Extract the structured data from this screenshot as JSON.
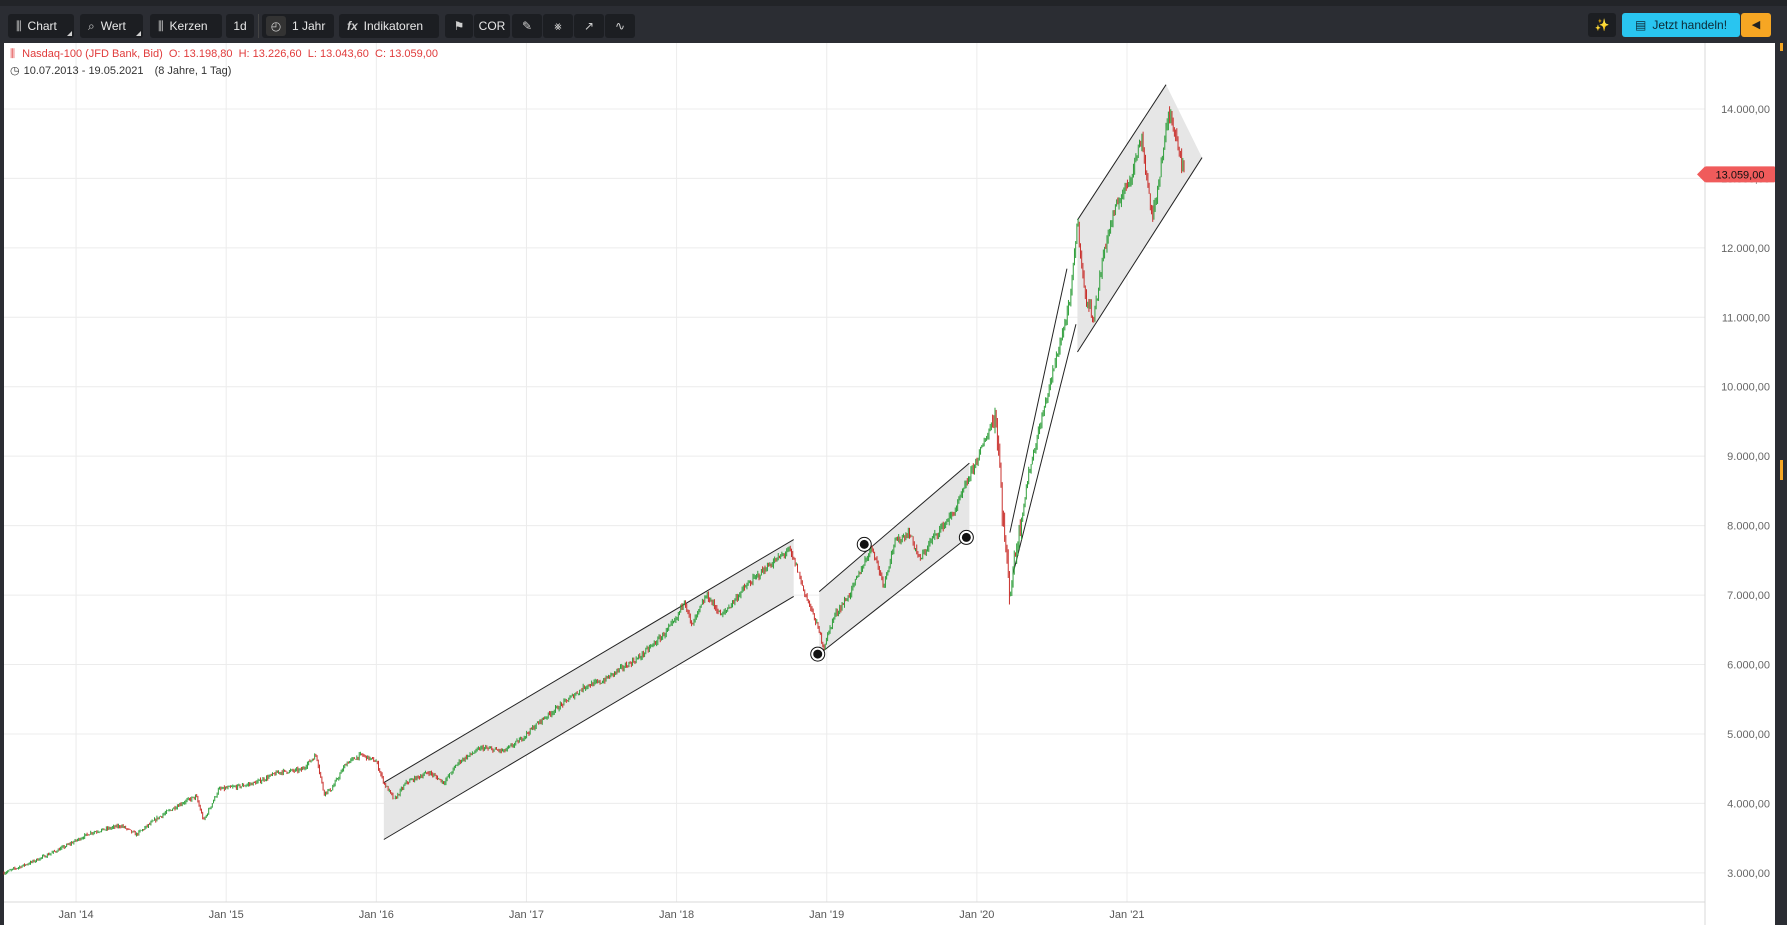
{
  "toolbar": {
    "chart_label": "Chart",
    "wert_label": "Wert",
    "kerzen_label": "Kerzen",
    "interval_label": "1d",
    "range_label": "1 Jahr",
    "indicators_label": "Indikatoren",
    "cor_label": "COR",
    "trade_label": "Jetzt handeln!"
  },
  "info": {
    "instrument": "Nasdaq-100 (JFD Bank, Bid)",
    "open": "O: 13.198,80",
    "high": "H: 13.226,60",
    "low": "L: 13.043,60",
    "close": "C: 13.059,00",
    "date_range": "10.07.2013 - 19.05.2021",
    "duration": "(8 Jahre, 1 Tag)"
  },
  "price_badge": "13.059,00",
  "colors": {
    "up": "#2e9e3a",
    "down": "#c9302c",
    "accent": "#f6a623",
    "trade": "#29c5f0",
    "badge": "#f05b5b"
  },
  "chart_data": {
    "type": "candlestick",
    "y_ticks": [
      "3.000,00",
      "4.000,00",
      "5.000,00",
      "6.000,00",
      "7.000,00",
      "8.000,00",
      "9.000,00",
      "10.000,00",
      "11.000,00",
      "12.000,00",
      "13.000,00",
      "14.000,00"
    ],
    "y_tick_values": [
      3000,
      4000,
      5000,
      6000,
      7000,
      8000,
      9000,
      10000,
      11000,
      12000,
      13000,
      14000
    ],
    "x_ticks": [
      "Jan '14",
      "Jan '15",
      "Jan '16",
      "Jan '17",
      "Jan '18",
      "Jan '19",
      "Jan '20",
      "Jan '21"
    ],
    "x_tick_values": [
      2014.0,
      2015.0,
      2016.0,
      2017.0,
      2018.0,
      2019.0,
      2020.0,
      2021.0
    ],
    "x_range": [
      2013.52,
      2024.85
    ],
    "y_range": [
      2580,
      14950
    ],
    "last_price": 13059,
    "price_path": [
      [
        2013.52,
        3000
      ],
      [
        2013.7,
        3150
      ],
      [
        2013.9,
        3350
      ],
      [
        2014.1,
        3580
      ],
      [
        2014.3,
        3680
      ],
      [
        2014.4,
        3550
      ],
      [
        2014.55,
        3800
      ],
      [
        2014.7,
        4000
      ],
      [
        2014.8,
        4100
      ],
      [
        2014.85,
        3750
      ],
      [
        2014.95,
        4200
      ],
      [
        2015.1,
        4250
      ],
      [
        2015.2,
        4300
      ],
      [
        2015.35,
        4450
      ],
      [
        2015.5,
        4480
      ],
      [
        2015.6,
        4700
      ],
      [
        2015.65,
        4150
      ],
      [
        2015.7,
        4200
      ],
      [
        2015.8,
        4580
      ],
      [
        2015.9,
        4700
      ],
      [
        2016.0,
        4600
      ],
      [
        2016.05,
        4300
      ],
      [
        2016.12,
        4050
      ],
      [
        2016.2,
        4300
      ],
      [
        2016.35,
        4450
      ],
      [
        2016.45,
        4300
      ],
      [
        2016.55,
        4600
      ],
      [
        2016.7,
        4800
      ],
      [
        2016.85,
        4750
      ],
      [
        2016.95,
        4900
      ],
      [
        2017.1,
        5200
      ],
      [
        2017.25,
        5450
      ],
      [
        2017.4,
        5700
      ],
      [
        2017.5,
        5750
      ],
      [
        2017.6,
        5900
      ],
      [
        2017.75,
        6100
      ],
      [
        2017.9,
        6400
      ],
      [
        2018.0,
        6650
      ],
      [
        2018.05,
        6950
      ],
      [
        2018.1,
        6550
      ],
      [
        2018.2,
        7000
      ],
      [
        2018.3,
        6700
      ],
      [
        2018.45,
        7100
      ],
      [
        2018.6,
        7400
      ],
      [
        2018.75,
        7650
      ],
      [
        2018.8,
        7400
      ],
      [
        2018.85,
        7050
      ],
      [
        2018.93,
        6600
      ],
      [
        2018.98,
        6250
      ],
      [
        2019.05,
        6700
      ],
      [
        2019.15,
        7000
      ],
      [
        2019.3,
        7700
      ],
      [
        2019.38,
        7150
      ],
      [
        2019.45,
        7750
      ],
      [
        2019.55,
        7900
      ],
      [
        2019.62,
        7500
      ],
      [
        2019.7,
        7800
      ],
      [
        2019.85,
        8200
      ],
      [
        2019.95,
        8700
      ],
      [
        2020.05,
        9200
      ],
      [
        2020.12,
        9600
      ],
      [
        2020.14,
        9300
      ],
      [
        2020.17,
        8200
      ],
      [
        2020.22,
        7000
      ],
      [
        2020.25,
        7500
      ],
      [
        2020.35,
        8800
      ],
      [
        2020.45,
        9700
      ],
      [
        2020.55,
        10600
      ],
      [
        2020.62,
        11200
      ],
      [
        2020.67,
        12400
      ],
      [
        2020.72,
        11300
      ],
      [
        2020.78,
        11000
      ],
      [
        2020.85,
        12000
      ],
      [
        2020.9,
        12400
      ],
      [
        2020.95,
        12700
      ],
      [
        2021.02,
        13000
      ],
      [
        2021.1,
        13600
      ],
      [
        2021.12,
        13200
      ],
      [
        2021.17,
        12400
      ],
      [
        2021.22,
        13100
      ],
      [
        2021.28,
        13950
      ],
      [
        2021.32,
        13700
      ],
      [
        2021.35,
        13400
      ],
      [
        2021.38,
        13060
      ]
    ],
    "channels": [
      {
        "a1": [
          2016.05,
          4300
        ],
        "a2": [
          2018.78,
          7800
        ],
        "b1": [
          2016.05,
          3480
        ],
        "b2": [
          2018.78,
          6980
        ]
      },
      {
        "a1": [
          2018.95,
          7050
        ],
        "a2": [
          2019.95,
          8900
        ],
        "b1": [
          2018.95,
          6150
        ],
        "b2": [
          2019.95,
          7850
        ]
      },
      {
        "a1": [
          2020.67,
          12400
        ],
        "a2": [
          2021.26,
          14350
        ],
        "b1": [
          2020.67,
          10500
        ],
        "b2": [
          2021.5,
          13300
        ]
      }
    ],
    "trend_lines": [
      [
        [
          2020.22,
          7900
        ],
        [
          2020.6,
          11700
        ]
      ],
      [
        [
          2020.24,
          7300
        ],
        [
          2020.66,
          10900
        ]
      ]
    ],
    "markers": [
      [
        2018.94,
        6150
      ],
      [
        2019.25,
        7730
      ],
      [
        2019.93,
        7830
      ]
    ]
  }
}
